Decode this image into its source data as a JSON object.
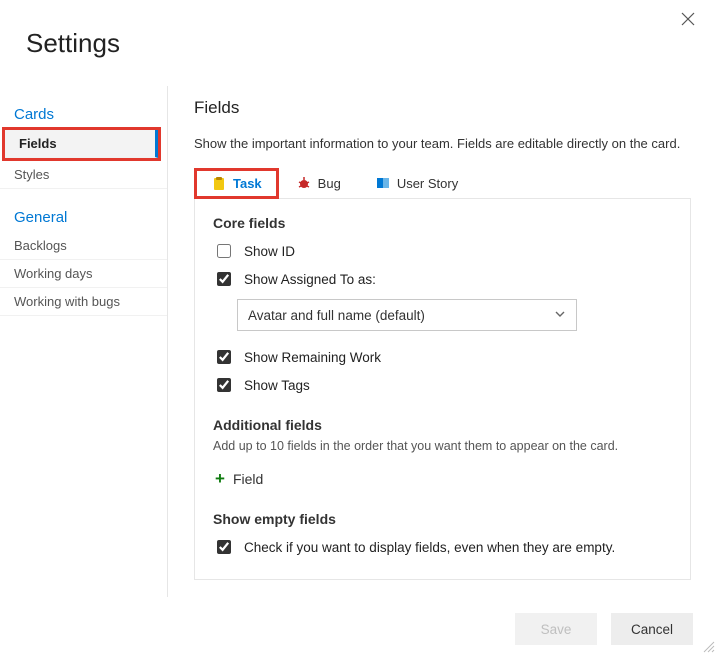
{
  "header": {
    "title": "Settings"
  },
  "sidebar": {
    "group1_title": "Cards",
    "group1_items": [
      {
        "label": "Fields",
        "active": true
      },
      {
        "label": "Styles"
      }
    ],
    "group2_title": "General",
    "group2_items": [
      {
        "label": "Backlogs"
      },
      {
        "label": "Working days"
      },
      {
        "label": "Working with bugs"
      }
    ]
  },
  "main": {
    "heading": "Fields",
    "hint": "Show the important information to your team. Fields are editable directly on the card.",
    "tabs": [
      {
        "label": "Task",
        "icon": "task"
      },
      {
        "label": "Bug",
        "icon": "bug"
      },
      {
        "label": "User Story",
        "icon": "story"
      }
    ],
    "core": {
      "title": "Core fields",
      "show_id_label": "Show ID",
      "show_id_checked": false,
      "show_assigned_label": "Show Assigned To as:",
      "show_assigned_checked": true,
      "assigned_select_value": "Avatar and full name (default)",
      "show_remaining_label": "Show Remaining Work",
      "show_remaining_checked": true,
      "show_tags_label": "Show Tags",
      "show_tags_checked": true
    },
    "additional": {
      "title": "Additional fields",
      "hint": "Add up to 10 fields in the order that you want them to appear on the card.",
      "add_label": "Field"
    },
    "empty": {
      "title": "Show empty fields",
      "label": "Check if you want to display fields, even when they are empty.",
      "checked": true
    }
  },
  "footer": {
    "save": "Save",
    "cancel": "Cancel"
  }
}
